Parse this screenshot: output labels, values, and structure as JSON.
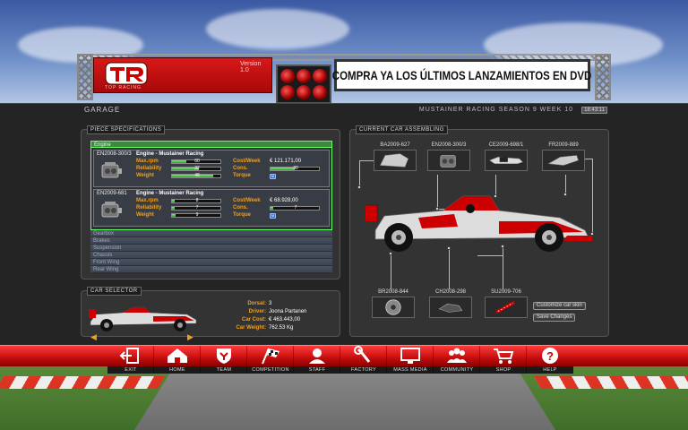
{
  "banner": {
    "version": "Version 1.0",
    "logo_sub": "TOP RACING",
    "ad_text": "COMPRA YA LOS ÚLTIMOS LANZAMIENTOS EN DVD"
  },
  "header": {
    "page_title": "GARAGE",
    "season_text": "MUSTAINER RACING SEASON 9 WEEK 10",
    "clock": "18:43:11"
  },
  "piece_specs": {
    "title": "PIECE SPECIFICATIONS",
    "active_category": "Engine",
    "engines": [
      {
        "id": "EN2008-300/3",
        "name": "Engine - Mustainer Racing",
        "maxrpm_label": "Max.rpm",
        "maxrpm": "60",
        "maxrpm_frac": 0.3,
        "reliability_label": "Reliability",
        "reliability": "32",
        "reliability_frac": 0.55,
        "weight_label": "Weight",
        "weight": "48",
        "weight_frac": 0.85,
        "cost_label": "Cost/Week",
        "cost": "€ 121.171,00",
        "cons_label": "Cons.",
        "cons": "30",
        "cons_frac": 0.5,
        "torque_label": "Torque",
        "torque_icon": "M"
      },
      {
        "id": "EN2009-681",
        "name": "Engine - Mustainer Racing",
        "maxrpm_label": "Max.rpm",
        "maxrpm": "8",
        "maxrpm_frac": 0.06,
        "reliability_label": "Reliability",
        "reliability": "7",
        "reliability_frac": 0.05,
        "weight_label": "Weight",
        "weight": "9",
        "weight_frac": 0.07,
        "cost_label": "Cost/Week",
        "cost": "€ 68.928,00",
        "cons_label": "Cons.",
        "cons": "7",
        "cons_frac": 0.05,
        "torque_label": "Torque",
        "torque_icon": "M"
      }
    ],
    "other_categories": [
      "Gearbox",
      "Brakes",
      "Suspension",
      "Chassis",
      "Front Wing",
      "Rear Wing"
    ]
  },
  "car_selector": {
    "title": "CAR SELECTOR",
    "dorsal_label": "Dorsal:",
    "dorsal": "3",
    "driver_label": "Driver:",
    "driver": "Joona Partanen",
    "cost_label": "Car Cost:",
    "cost": "€ 463.443,00",
    "weight_label": "Car Weight:",
    "weight": "762.53 Kg"
  },
  "assembling": {
    "title": "CURRENT CAR ASSEMBLING",
    "top_parts": [
      "BA2009-627",
      "EN2008-300/3",
      "CE2009-698/1",
      "FR2009-889"
    ],
    "bottom_parts": [
      "BR2008-844",
      "CH2008-298",
      "SU2009-706"
    ],
    "customize_label": "Customize car skin",
    "save_label": "Save Changes"
  },
  "nav": [
    {
      "label": "EXIT",
      "icon": "exit-icon"
    },
    {
      "label": "HOME",
      "icon": "home-icon"
    },
    {
      "label": "TEAM",
      "icon": "team-shield-icon"
    },
    {
      "label": "COMPETITION",
      "icon": "checkered-flag-icon"
    },
    {
      "label": "STAFF",
      "icon": "staff-icon"
    },
    {
      "label": "FACTORY",
      "icon": "wrench-icon"
    },
    {
      "label": "MASS MEDIA",
      "icon": "monitor-icon"
    },
    {
      "label": "COMMUNITY",
      "icon": "community-icon"
    },
    {
      "label": "SHOP",
      "icon": "cart-icon"
    },
    {
      "label": "HELP",
      "icon": "help-icon"
    }
  ],
  "colors": {
    "accent_orange": "#f0a020",
    "nav_red": "#d81818",
    "active_green": "#3d8a3d"
  }
}
